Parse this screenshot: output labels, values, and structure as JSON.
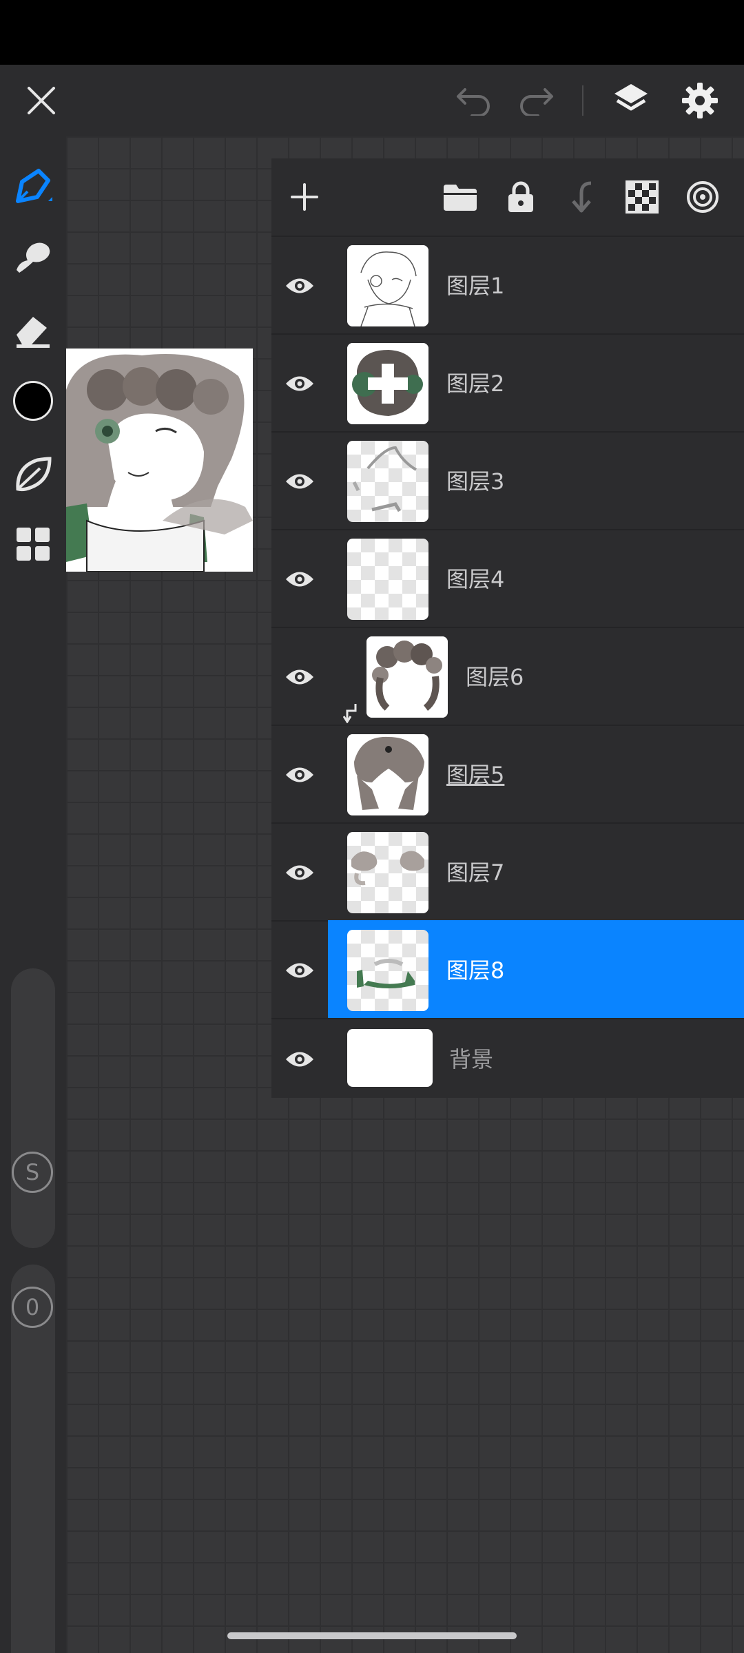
{
  "colors": {
    "accent": "#0a84ff",
    "panel_bg": "#2c2c2e",
    "canvas_bg": "#373739",
    "current_color": "#000000"
  },
  "topbar": {
    "icons": [
      "close-icon",
      "undo-icon",
      "redo-icon",
      "layers-icon",
      "settings-icon"
    ]
  },
  "toolbar": {
    "tools": [
      "brush-icon",
      "smudge-icon",
      "eraser-icon",
      "color-swatch",
      "leaf-icon",
      "grid-icon"
    ],
    "size_badge": "S",
    "opacity_badge": "0"
  },
  "layers_panel": {
    "toolbar_icons": [
      "add-layer-icon",
      "folder-icon",
      "lock-icon",
      "merge-down-icon",
      "transparency-icon",
      "reference-icon"
    ],
    "layers": [
      {
        "name": "图层1"
      },
      {
        "name": "图层2"
      },
      {
        "name": "图层3"
      },
      {
        "name": "图层4"
      },
      {
        "name": "图层6",
        "clipped": true
      },
      {
        "name": "图层5"
      },
      {
        "name": "图层7"
      },
      {
        "name": "图层8",
        "selected": true
      },
      {
        "name": "背景"
      }
    ]
  }
}
